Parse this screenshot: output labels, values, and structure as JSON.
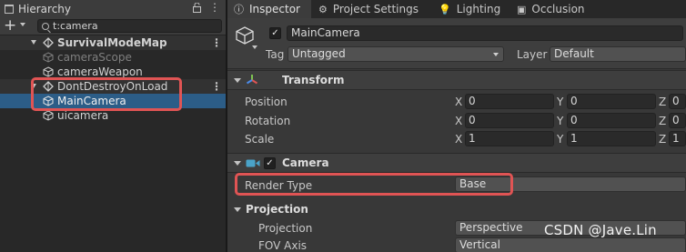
{
  "hierarchy": {
    "tab_label": "Hierarchy",
    "search_value": "t:camera",
    "rows": [
      {
        "label": "SurvivalModeMap",
        "kind": "scene"
      },
      {
        "label": "cameraScope",
        "kind": "inactive"
      },
      {
        "label": "cameraWeapon",
        "kind": "normal"
      },
      {
        "label": "DontDestroyOnLoad",
        "kind": "scene"
      },
      {
        "label": "MainCamera",
        "kind": "selected"
      },
      {
        "label": "uicamera",
        "kind": "normal"
      }
    ]
  },
  "inspector": {
    "tabs": [
      "Inspector",
      "Project Settings",
      "Lighting",
      "Occlusion"
    ],
    "object_name": "MainCamera",
    "tag_label": "Tag",
    "tag_value": "Untagged",
    "layer_label": "Layer",
    "layer_value": "Default",
    "transform": {
      "title": "Transform",
      "rows": [
        {
          "label": "Position",
          "x": "0",
          "y": "0",
          "z": "0"
        },
        {
          "label": "Rotation",
          "x": "0",
          "y": "0",
          "z": "0"
        },
        {
          "label": "Scale",
          "x": "1",
          "y": "1",
          "z": "1"
        }
      ],
      "axis_labels": [
        "X",
        "Y",
        "Z"
      ]
    },
    "camera": {
      "title": "Camera",
      "render_type_label": "Render Type",
      "render_type_value": "Base",
      "projection_section": "Projection",
      "projection_label": "Projection",
      "projection_value": "Perspective",
      "fov_axis_label": "FOV Axis",
      "fov_axis_value": "Vertical"
    }
  },
  "watermark": "CSDN @Jave.Lin",
  "colors": {
    "highlight": "#e05454",
    "selection": "#2c5d87"
  }
}
